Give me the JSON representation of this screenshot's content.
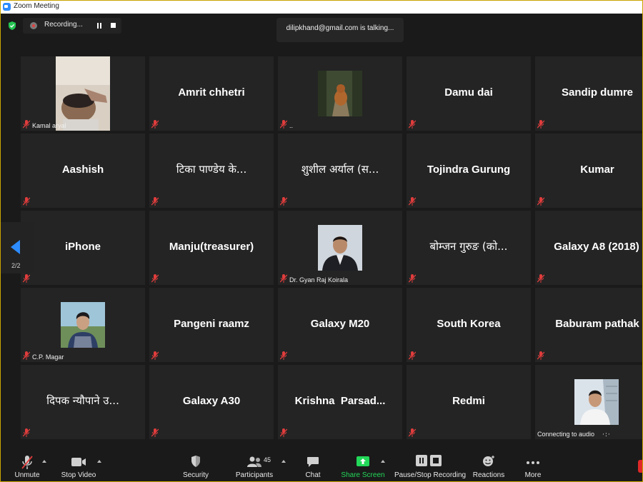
{
  "window": {
    "title": "Zoom Meeting"
  },
  "recording": {
    "label": "Recording..."
  },
  "speaker": {
    "text": "dilipkhand@gmail.com is talking..."
  },
  "pager": {
    "label": "2/2"
  },
  "colors": {
    "accent": "#2d8cff",
    "share_green": "#23d959",
    "muted_red": "#e03c3c",
    "leave_red": "#e02828"
  },
  "participants": [
    {
      "name": "Kamal aryal",
      "type": "video"
    },
    {
      "name": "Amrit chhetri",
      "type": "name"
    },
    {
      "name": "..",
      "type": "video"
    },
    {
      "name": "Damu dai",
      "type": "name"
    },
    {
      "name": "Sandip dumre",
      "type": "name"
    },
    {
      "name": "Aashish",
      "type": "name"
    },
    {
      "name": "टिका पाण्डेय के...",
      "type": "name"
    },
    {
      "name": "शुशील अर्याल (स...",
      "type": "name"
    },
    {
      "name": "Tojindra Gurung",
      "type": "name"
    },
    {
      "name": "Kumar",
      "type": "name"
    },
    {
      "name": "iPhone",
      "type": "name"
    },
    {
      "name": "Manju(treasurer)",
      "type": "name"
    },
    {
      "name": "Dr. Gyan Raj Koirala",
      "type": "video"
    },
    {
      "name": "बोम्जन गुरुङ (को...",
      "type": "name"
    },
    {
      "name": "Galaxy A8 (2018)",
      "type": "name"
    },
    {
      "name": "C.P. Magar",
      "type": "video"
    },
    {
      "name": "Pangeni raamz",
      "type": "name"
    },
    {
      "name": "Galaxy M20",
      "type": "name"
    },
    {
      "name": "South Korea",
      "type": "name"
    },
    {
      "name": "Baburam pathak",
      "type": "name"
    },
    {
      "name": "दिपक न्यौपाने उ...",
      "type": "name"
    },
    {
      "name": "Galaxy A30",
      "type": "name"
    },
    {
      "name": "Krishna  Parsad...",
      "type": "name"
    },
    {
      "name": "Redmi",
      "type": "name"
    },
    {
      "name": "Connecting to audio",
      "type": "video"
    }
  ],
  "toolbar": {
    "unmute": "Unmute",
    "stop_video": "Stop Video",
    "security": "Security",
    "participants": "Participants",
    "participants_count": "45",
    "chat": "Chat",
    "share_screen": "Share Screen",
    "pause_stop_recording": "Pause/Stop Recording",
    "reactions": "Reactions",
    "more": "More"
  }
}
